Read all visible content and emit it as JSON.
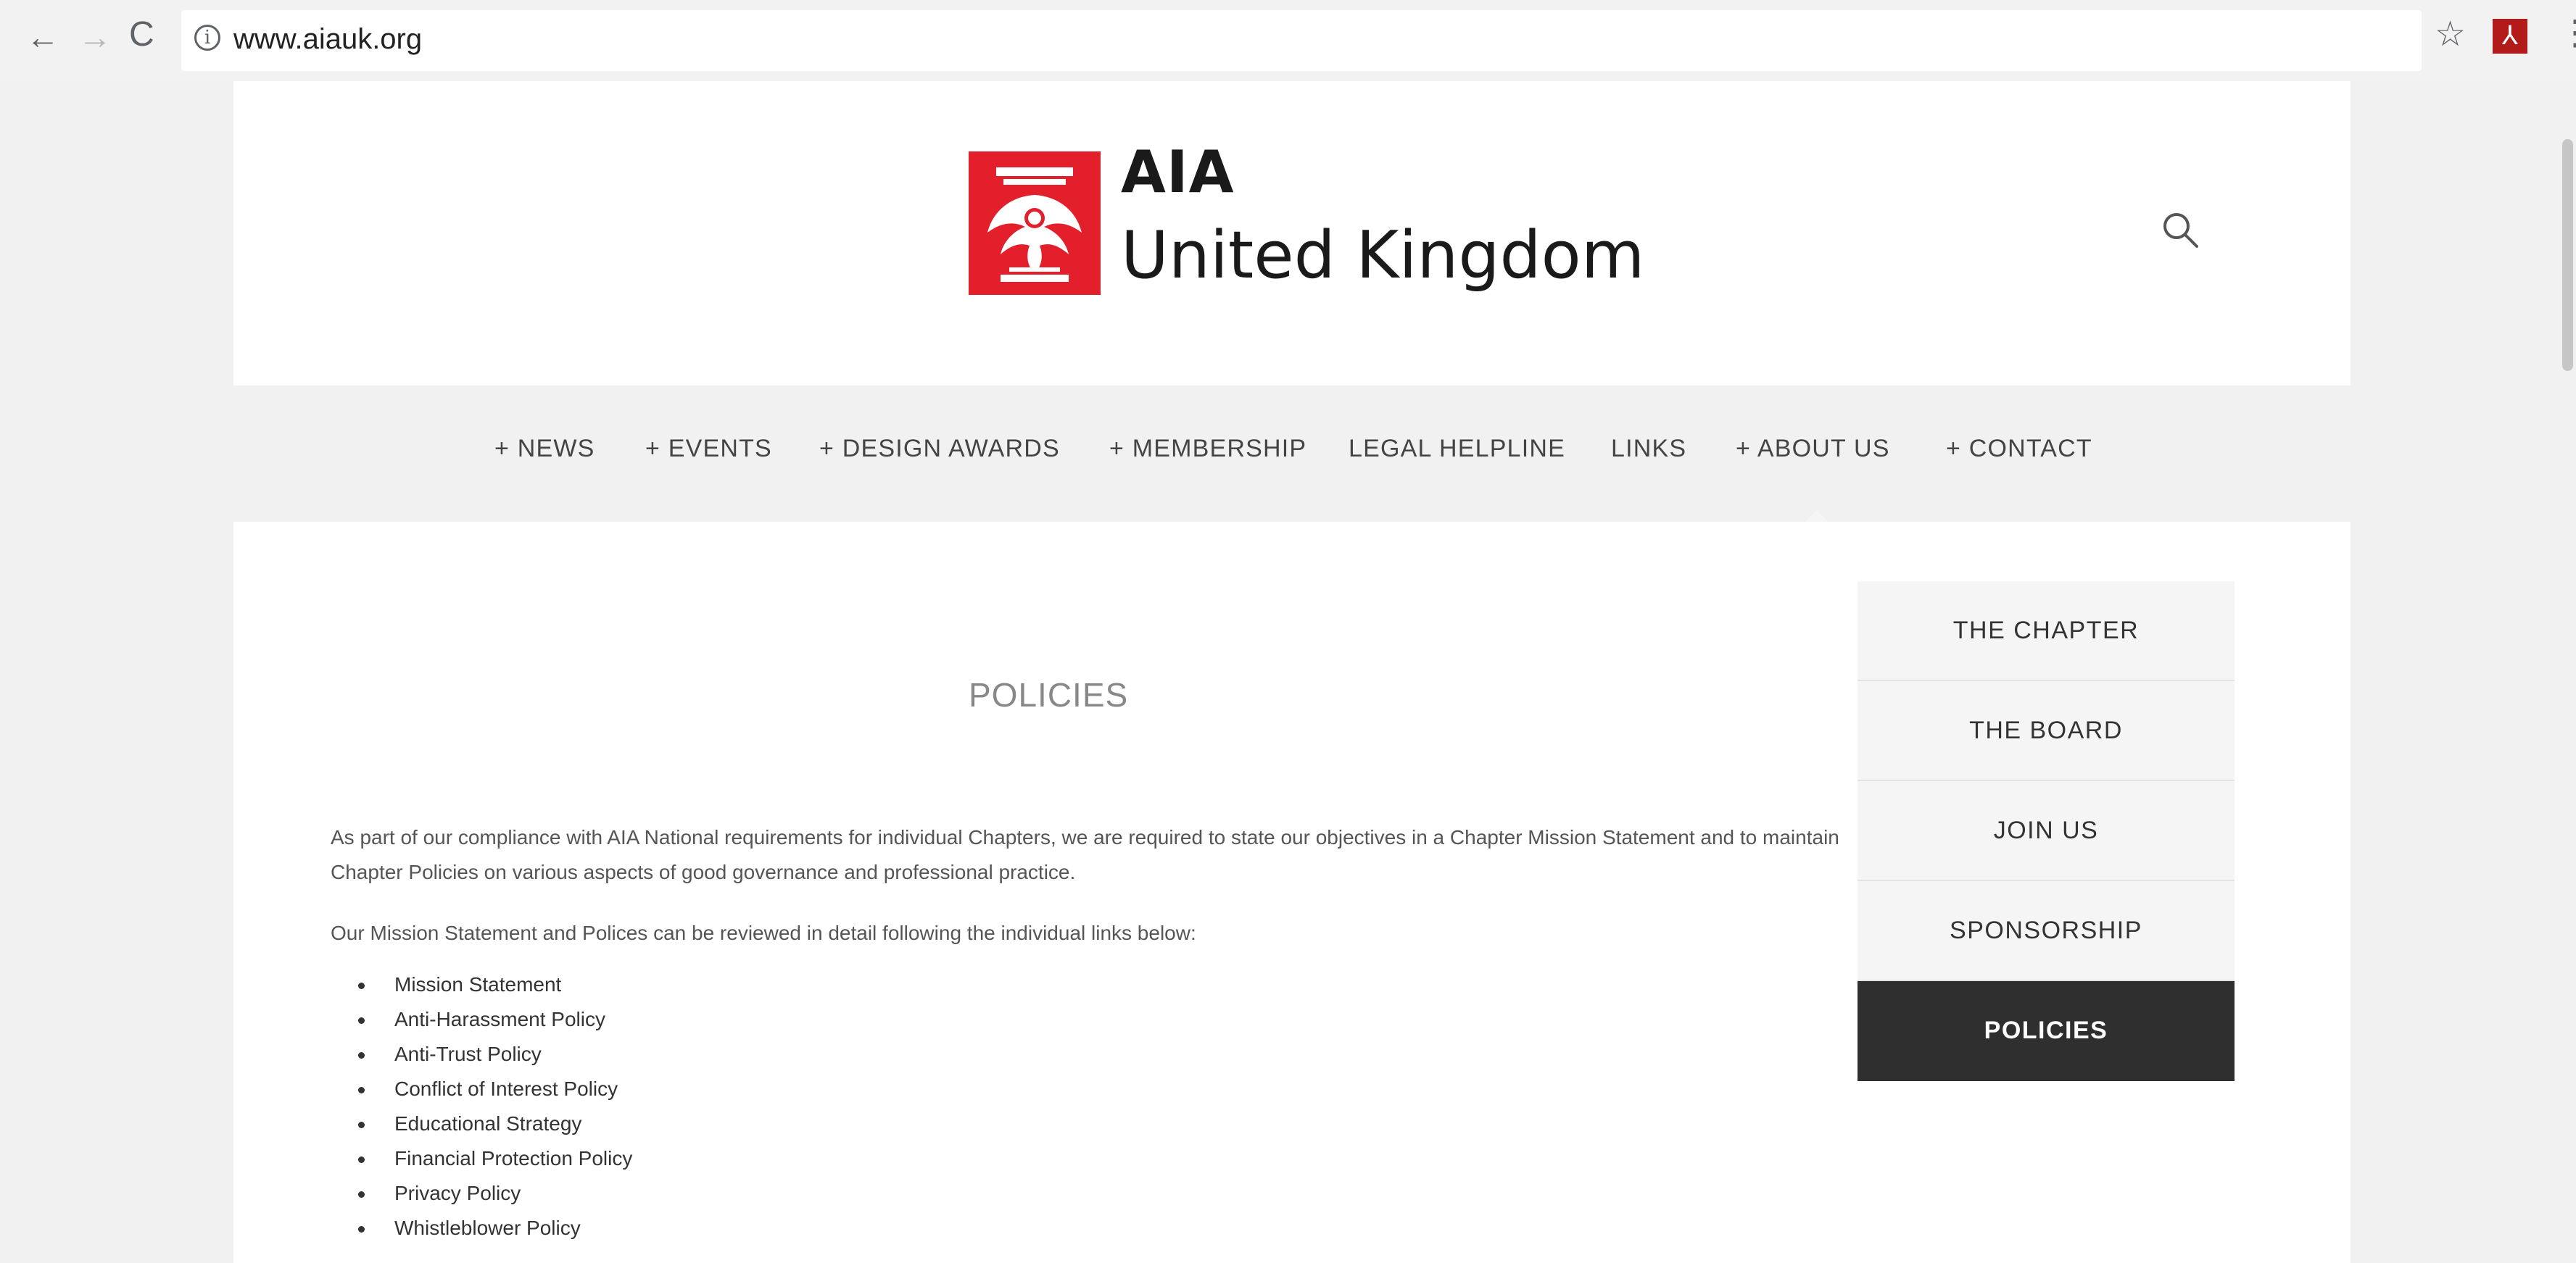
{
  "browser": {
    "back_label": "←",
    "forward_label": "→",
    "reload_label": "C",
    "info_label": "i",
    "url": "www.aiauk.org",
    "bookmark_label": "☆",
    "menu_label": "⋮"
  },
  "header": {
    "logo_line1": "AIA",
    "logo_line2": "United Kingdom",
    "brand_color": "#e21f2b"
  },
  "nav": {
    "items": [
      {
        "label": "+ NEWS"
      },
      {
        "label": "+ EVENTS"
      },
      {
        "label": "+ DESIGN AWARDS"
      },
      {
        "label": "+ MEMBERSHIP"
      },
      {
        "label": "LEGAL HELPLINE"
      },
      {
        "label": "LINKS"
      },
      {
        "label": "+ ABOUT US"
      },
      {
        "label": "+ CONTACT"
      }
    ]
  },
  "dropdown": {
    "items": [
      {
        "label": "THE CHAPTER"
      },
      {
        "label": "THE BOARD"
      },
      {
        "label": "JOIN US"
      },
      {
        "label": "SPONSORSHIP"
      },
      {
        "label": "POLICIES"
      }
    ],
    "active": "POLICIES"
  },
  "main": {
    "title": "POLICIES",
    "paragraph1": "As part of our compliance with AIA National requirements for individual Chapters, we are required to state our objectives in a Chapter Mission Statement and to maintain Chapter Policies on various aspects of good governance and professional practice.",
    "paragraph2": "Our Mission Statement and Polices can be reviewed in detail following the individual links below:",
    "policies": [
      "Mission Statement",
      "Anti-Harassment Policy",
      "Anti-Trust Policy",
      "Conflict of Interest Policy",
      "Educational Strategy",
      "Financial Protection Policy",
      "Privacy Policy",
      "Whistleblower Policy"
    ]
  }
}
